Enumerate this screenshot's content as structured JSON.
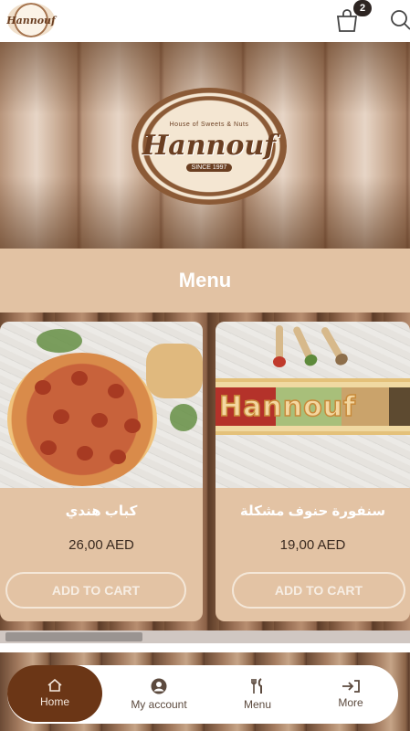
{
  "header": {
    "logo_text": "Hannouf",
    "cart_icon": "shopping-bag-icon",
    "cart_count": "2",
    "search_icon": "search-icon"
  },
  "hero": {
    "logo_arc_text": "House of Sweets & Nuts",
    "logo_script": "Hannouf",
    "logo_since": "SINCE 1997"
  },
  "section": {
    "title": "Menu"
  },
  "products": [
    {
      "name": "كباب هندي",
      "price": "26,00 AED",
      "button": "ADD TO CART"
    },
    {
      "name": "سنفورة حنوف مشكلة",
      "price": "19,00 AED",
      "button": "ADD TO CART"
    }
  ],
  "board_text": "Hannouf",
  "nav": {
    "items": [
      {
        "label": "Home",
        "icon": "home-icon",
        "active": true
      },
      {
        "label": "My account",
        "icon": "user-icon"
      },
      {
        "label": "Menu",
        "icon": "fork-knife-icon"
      },
      {
        "label": "More",
        "icon": "sign-in-icon"
      }
    ]
  },
  "colors": {
    "accent": "#6b3616",
    "card": "#e3c3a4",
    "title_bar": "#e2c2a3"
  }
}
